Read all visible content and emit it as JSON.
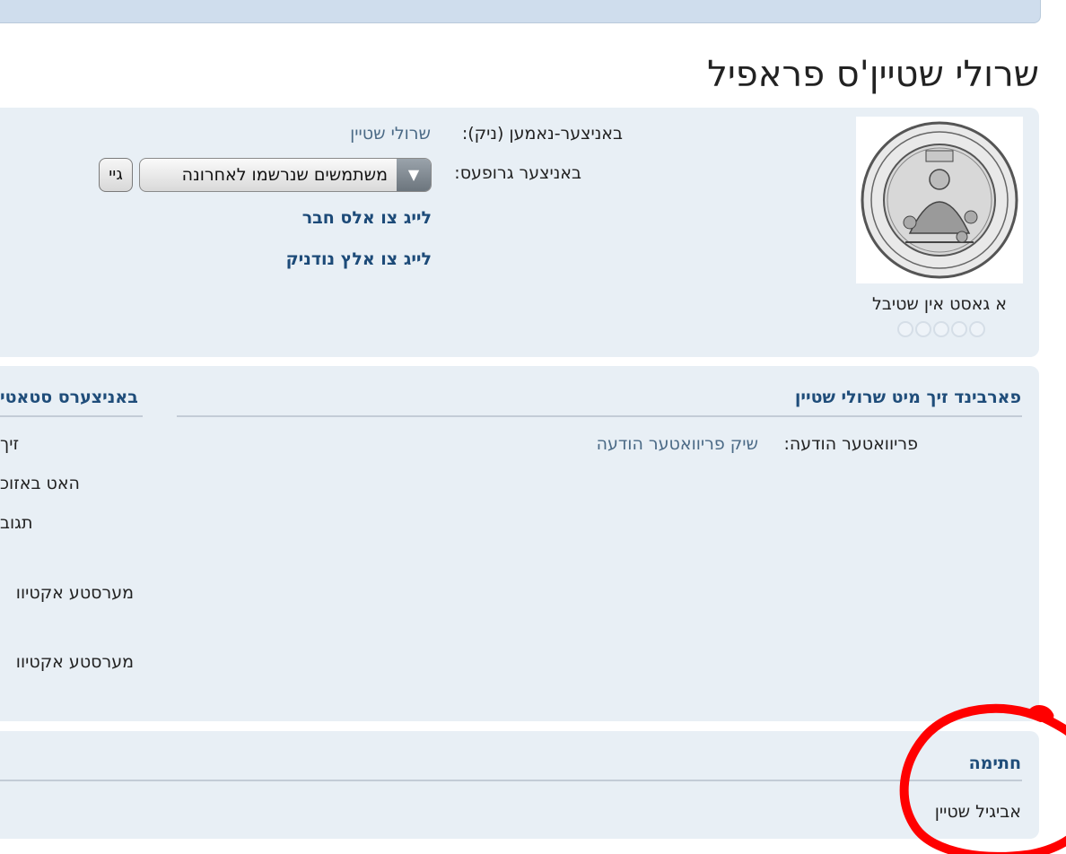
{
  "profile": {
    "title": "שרולי שטיין'ס פראפיל",
    "user_title": "א גאסט אין שטיבל",
    "reputation_dots": 5,
    "nickname_label": "באניצער-נאמען (ניק):",
    "nickname_value": "שרולי שטיין",
    "groups_label": "באניצער גרופעס:",
    "groups_select_value": "משתמשים שנרשמו לאחרונה",
    "go_button": "גיי",
    "add_friend_link": "לייג צו אלס חבר",
    "add_contact_link": "לייג צו אלץ נודניק"
  },
  "contact": {
    "heading": "פארבינד זיך מיט שרולי שטיין",
    "pm_label": "פריוואטער הודעה:",
    "pm_link": "שיק פריוואטער הודעה"
  },
  "stats": {
    "heading": "באניצערס סטאטי",
    "rows": [
      "זיך",
      "האט באזוכ",
      "תגוב",
      "מערסטע אקטיוו",
      "מערסטע אקטיוו"
    ]
  },
  "signature": {
    "heading": "חתימה",
    "text": "אביגיל שטיין"
  },
  "colors": {
    "panel_bg": "#e8eff5",
    "link_blue": "#1c4a78",
    "annotation_red": "#ff0000"
  }
}
